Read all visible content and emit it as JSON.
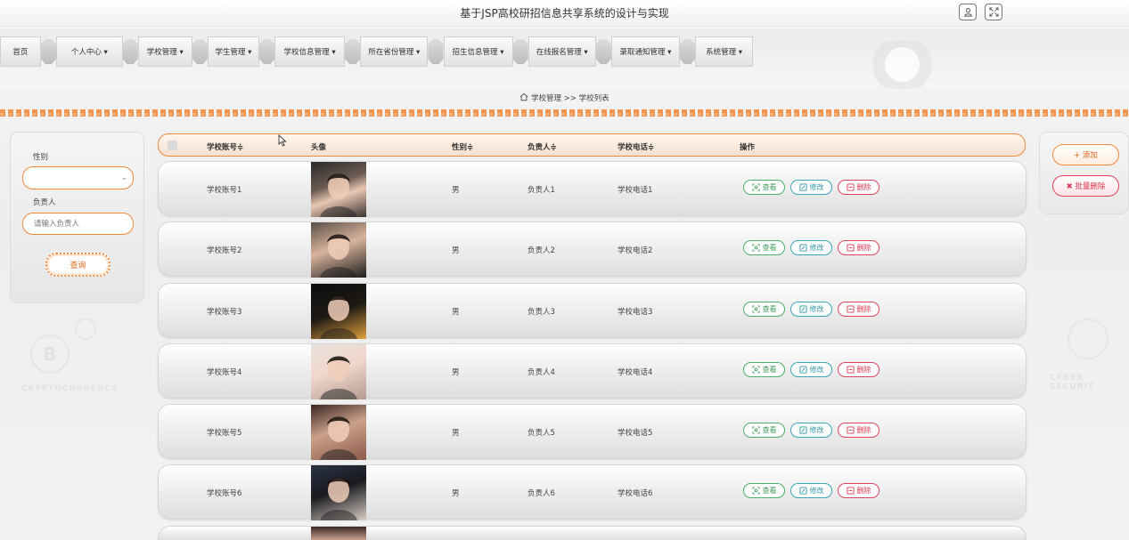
{
  "header": {
    "title": "基于JSP高校研招信息共享系统的设计与实现",
    "user_icon": "user-icon",
    "fullscreen_icon": "fullscreen-icon"
  },
  "nav": {
    "items": [
      {
        "label": "首页"
      },
      {
        "label": "个人中心 ▾"
      },
      {
        "label": "学校管理 ▾"
      },
      {
        "label": "学生管理 ▾"
      },
      {
        "label": "学校信息管理 ▾"
      },
      {
        "label": "所在省份管理 ▾"
      },
      {
        "label": "招生信息管理 ▾"
      },
      {
        "label": "在线报名管理 ▾"
      },
      {
        "label": "录取通知管理 ▾"
      },
      {
        "label": "系统管理 ▾"
      }
    ]
  },
  "breadcrumb": {
    "home_icon": "home-icon",
    "text": "学校管理 >> 学校列表"
  },
  "search": {
    "gender_label": "性别",
    "gender_value": "",
    "manager_label": "负责人",
    "manager_placeholder": "请输入负责人",
    "query_button": "查询"
  },
  "actions": {
    "add_label": "+ 添加",
    "batch_delete_label": "✖ 批量删除"
  },
  "table": {
    "columns": {
      "account": "学校账号≑",
      "avatar": "头像",
      "gender": "性别≑",
      "manager": "负责人≑",
      "phone": "学校电话≑",
      "ops": "操作"
    },
    "buttons": {
      "view": "查看",
      "edit": "修改",
      "delete": "删除"
    },
    "rows": [
      {
        "account": "学校账号1",
        "gender": "男",
        "manager": "负责人1",
        "phone": "学校电话1"
      },
      {
        "account": "学校账号2",
        "gender": "男",
        "manager": "负责人2",
        "phone": "学校电话2"
      },
      {
        "account": "学校账号3",
        "gender": "男",
        "manager": "负责人3",
        "phone": "学校电话3"
      },
      {
        "account": "学校账号4",
        "gender": "男",
        "manager": "负责人4",
        "phone": "学校电话4"
      },
      {
        "account": "学校账号5",
        "gender": "男",
        "manager": "负责人5",
        "phone": "学校电话5"
      },
      {
        "account": "学校账号6",
        "gender": "男",
        "manager": "负责人6",
        "phone": "学校电话6"
      }
    ]
  },
  "decorations": {
    "left_text": "CRYPTOCURRENCY",
    "right_text": "CYBER SECURIT"
  },
  "colors": {
    "accent": "#f08a3c",
    "view": "#4caf6a",
    "edit": "#3aa5b5",
    "delete": "#e0435e"
  }
}
